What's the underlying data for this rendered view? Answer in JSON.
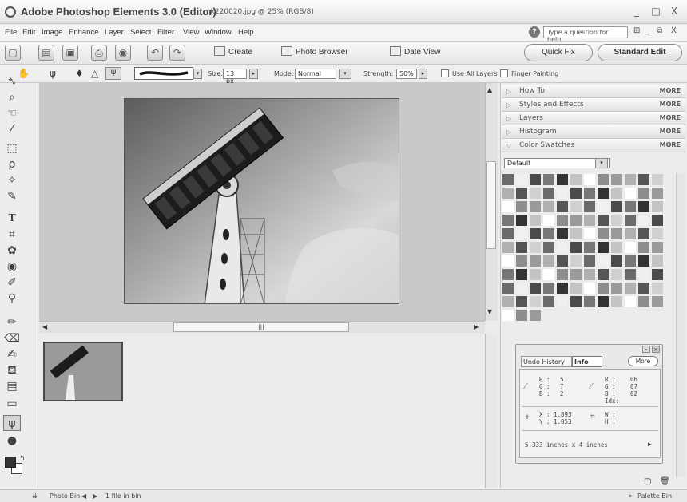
{
  "window": {
    "app_title": "Adobe Photoshop Elements 3.0 (Editor)",
    "doc_title": "nk220020.jpg @ 25% (RGB/8)",
    "controls": [
      "_",
      "□",
      "X"
    ]
  },
  "menubar": {
    "items": [
      "File",
      "Edit",
      "Image",
      "Enhance",
      "Layer",
      "Select",
      "Filter",
      "View",
      "Window",
      "Help"
    ],
    "help_placeholder": "Type a question for help",
    "mdi_controls": [
      "⊞",
      "_",
      "⧉",
      "X"
    ]
  },
  "shortcuts": {
    "create_label": "Create",
    "photo_browser_label": "Photo Browser",
    "date_view_label": "Date View",
    "quick_fix_label": "Quick Fix",
    "standard_edit_label": "Standard Edit"
  },
  "options": {
    "size_label": "Size:",
    "size_value": "13 px",
    "mode_label": "Mode:",
    "mode_value": "Normal",
    "strength_label": "Strength:",
    "strength_value": "50%",
    "use_all_layers_label": "Use All Layers",
    "finger_painting_label": "Finger Painting"
  },
  "palettes": [
    {
      "name": "How To",
      "more": "MORE"
    },
    {
      "name": "Styles and Effects",
      "more": "MORE"
    },
    {
      "name": "Layers",
      "more": "MORE"
    },
    {
      "name": "Histogram",
      "more": "MORE"
    },
    {
      "name": "Color Swatches",
      "more": "MORE"
    }
  ],
  "swatch_set": "Default",
  "info": {
    "tab_undo": "Undo History",
    "tab_info": "Info",
    "more": "More",
    "r1": "R :",
    "r1v": "5",
    "g1": "G :",
    "g1v": "7",
    "b1": "B :",
    "b1v": "2",
    "r2": "R :",
    "r2v": "06",
    "g2": "G :",
    "g2v": "07",
    "b2": "B :",
    "b2v": "02",
    "idx": "Idx:",
    "x": "X :",
    "xv": "1.893",
    "y": "Y :",
    "yv": "1.053",
    "w": "W :",
    "h": "H :",
    "doc_size": "5.333 inches x 4 inches"
  },
  "status": {
    "photo_bin": "Photo Bin",
    "file_count": "1 file in bin",
    "palette_bin": "Palette Bin"
  },
  "hscroll_marker": "|||",
  "palette_tabs_icons": [
    "▢",
    "🗑"
  ]
}
